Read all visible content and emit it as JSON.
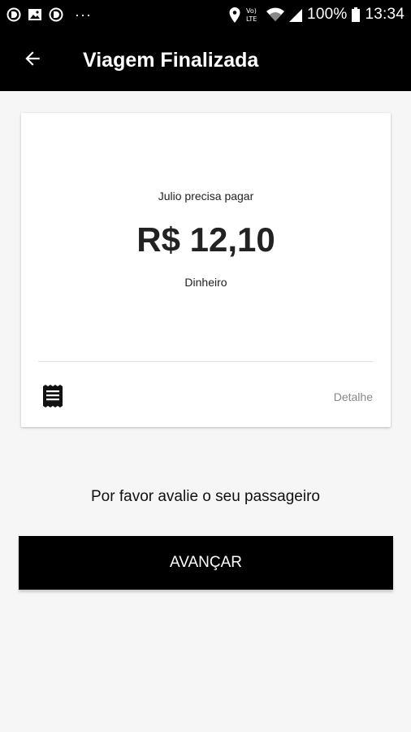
{
  "status_bar": {
    "left_icons": [
      "circle-d-icon",
      "image-icon",
      "circle-d-icon"
    ],
    "more_dots": "···",
    "volte_label": "Vo)\nLTE",
    "battery_percent": "100%",
    "time": "13:34"
  },
  "app_bar": {
    "back_icon": "arrow-back-icon",
    "title": "Viagem Finalizada"
  },
  "payment_card": {
    "label": "Julio precisa pagar",
    "amount": "R$ 12,10",
    "method": "Dinheiro",
    "receipt_icon": "receipt-icon",
    "details_link": "Detalhe"
  },
  "rating_prompt": "Por favor avalie o seu passageiro",
  "advance_button": "AVANÇAR",
  "colors": {
    "bar_background": "#000000",
    "page_background": "#f7f6f7",
    "card_background": "#ffffff",
    "muted_text": "#888888"
  }
}
